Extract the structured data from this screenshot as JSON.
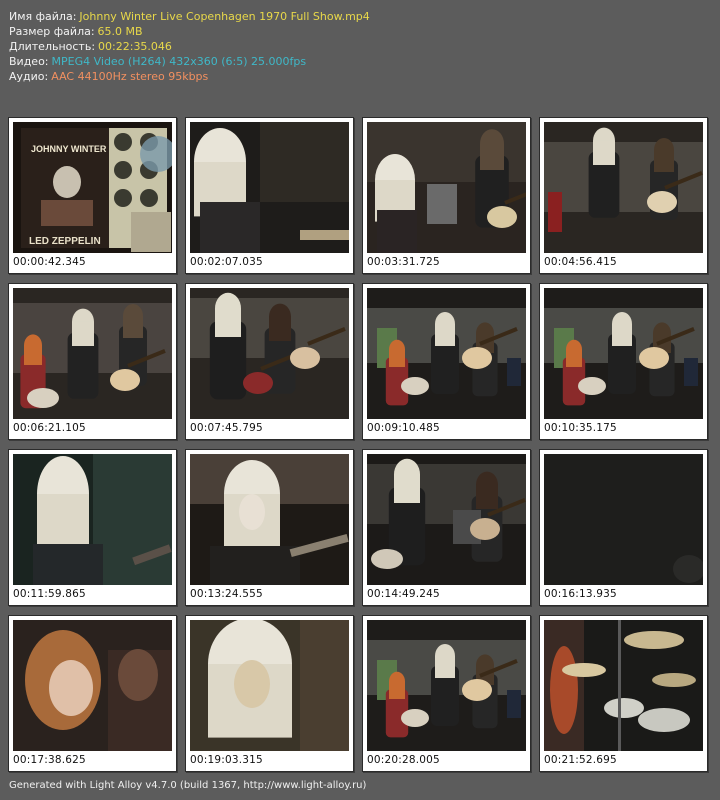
{
  "info": [
    {
      "key": "Имя файла:",
      "value": "Johnny Winter Live Copenhagen 1970 Full Show.mp4",
      "color": "#e8d84a"
    },
    {
      "key": "Размер файла:",
      "value": "65.0 MB",
      "color": "#e8d84a"
    },
    {
      "key": "Длительность:",
      "value": "00:22:35.046",
      "color": "#e8d84a"
    },
    {
      "key": "Видео:",
      "value": "MPEG4 Video (H264) 432x360 (6:5) 25.000fps",
      "color": "#3fb8c8"
    },
    {
      "key": "Аудио:",
      "value": "AAC 44100Hz stereo 95kbps",
      "color": "#f29060"
    }
  ],
  "thumbnails": [
    {
      "time": "00:00:42.345",
      "scene": "poster"
    },
    {
      "time": "00:02:07.035",
      "scene": "closeup-side"
    },
    {
      "time": "00:03:31.725",
      "scene": "band-guitar"
    },
    {
      "time": "00:04:56.415",
      "scene": "band-wide"
    },
    {
      "time": "00:06:21.105",
      "scene": "band-drums"
    },
    {
      "time": "00:07:45.795",
      "scene": "band-guitar-red"
    },
    {
      "time": "00:09:10.485",
      "scene": "stage-wide"
    },
    {
      "time": "00:10:35.175",
      "scene": "stage-wide"
    },
    {
      "time": "00:11:59.865",
      "scene": "blur-side"
    },
    {
      "time": "00:13:24.555",
      "scene": "face-closeup"
    },
    {
      "time": "00:14:49.245",
      "scene": "stage-standing"
    },
    {
      "time": "00:16:13.935",
      "scene": "dark"
    },
    {
      "time": "00:17:38.625",
      "scene": "drummer-face"
    },
    {
      "time": "00:19:03.315",
      "scene": "face-blur"
    },
    {
      "time": "00:20:28.005",
      "scene": "stage-wide"
    },
    {
      "time": "00:21:52.695",
      "scene": "cymbals"
    }
  ],
  "footer": "Generated with Light Alloy v4.7.0 (build 1367, http://www.light-alloy.ru)",
  "poster_text": [
    "JOHNNY WINTER",
    "LED ZEPPELIN"
  ]
}
